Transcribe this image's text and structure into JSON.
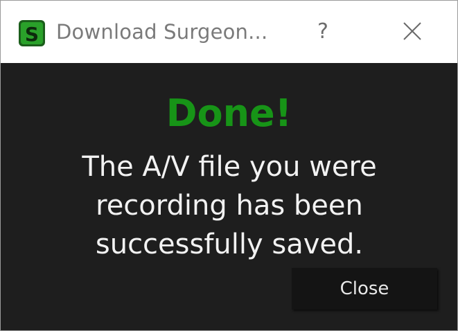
{
  "window": {
    "title": "Download Surgeon...",
    "help_label": "?",
    "app_icon": "surgeon-s-logo-icon",
    "close_icon": "close-icon"
  },
  "dialog": {
    "heading": "Done!",
    "message": "The A/V file you were recording has been successfully saved.",
    "close_button_label": "Close"
  },
  "colors": {
    "heading_green": "#179417",
    "body_background": "#1e1e1e",
    "message_text": "#f2f2f2",
    "title_text": "#7a7a7a"
  }
}
